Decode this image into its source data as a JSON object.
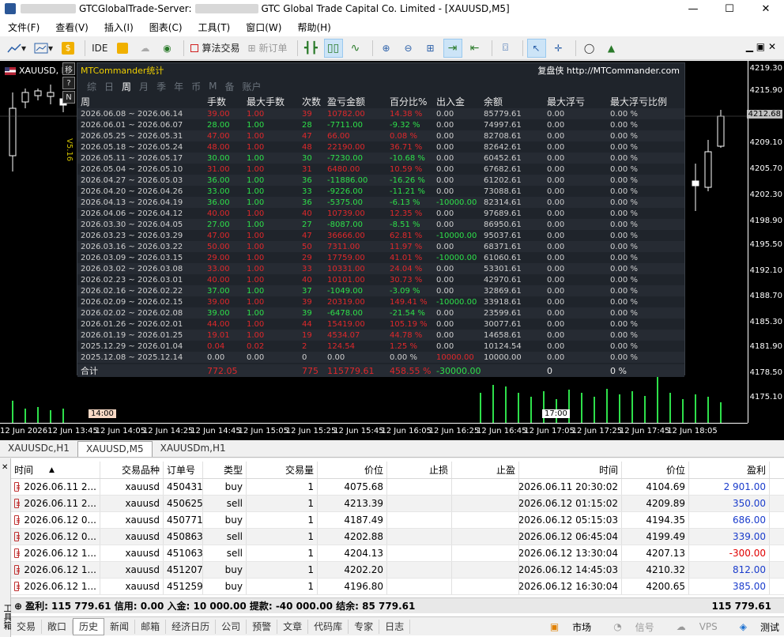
{
  "title": {
    "app": "GTCGlobalTrade-Server:",
    "company": "GTC Global Trade Capital Co. Limited - [XAUUSD,M5]"
  },
  "menu": [
    "文件(F)",
    "查看(V)",
    "插入(I)",
    "图表(C)",
    "工具(T)",
    "窗口(W)",
    "帮助(H)"
  ],
  "toolbar": {
    "ide": "IDE",
    "algo": "算法交易",
    "neworder": "新订单"
  },
  "chart": {
    "symbol": "XAUUSD, M5",
    "version": "V5.16",
    "side_buttons": [
      "移",
      "?",
      "N"
    ],
    "y_ticks": [
      "4219.30",
      "4215.90",
      "4212.68",
      "4209.10",
      "4205.70",
      "4202.30",
      "4198.90",
      "4195.50",
      "4192.10",
      "4188.70",
      "4185.30",
      "4181.90",
      "4178.50",
      "4175.10"
    ],
    "current_price": "4212.68",
    "x_ticks": [
      "12 Jun 2026",
      "12 Jun 13:45",
      "12 Jun 14:05",
      "12 Jun 14:25",
      "12 Jun 14:45",
      "12 Jun 15:05",
      "12 Jun 15:25",
      "12 Jun 15:45",
      "12 Jun 16:05",
      "12 Jun 16:25",
      "12 Jun 16:45",
      "12 Jun 17:05",
      "12 Jun 17:25",
      "12 Jun 17:45",
      "12 Jun 18:05"
    ],
    "marker_left": "14:00",
    "marker_right": "17:00"
  },
  "panel": {
    "title": "MTCommander统计",
    "link": "复盘侠 http://MTCommander.com",
    "tabs": [
      "综",
      "日",
      "周",
      "月",
      "季",
      "年",
      "币",
      "M",
      "备",
      "账户"
    ],
    "active_tab": "周",
    "headers": [
      "周",
      "手数",
      "最大手数",
      "次数",
      "盈亏金额",
      "百分比%",
      "出入金",
      "余额",
      "最大浮亏",
      "最大浮亏比例"
    ],
    "rows": [
      [
        "2026.06.08 ~ 2026.06.14",
        "39.00",
        "1.00",
        "39",
        "10782.00",
        "14.38 %",
        "0.00",
        "85779.61",
        "0.00",
        "0.00 %",
        "r"
      ],
      [
        "2026.06.01 ~ 2026.06.07",
        "28.00",
        "1.00",
        "28",
        "-7711.00",
        "-9.32 %",
        "0.00",
        "74997.61",
        "0.00",
        "0.00 %",
        "g"
      ],
      [
        "2026.05.25 ~ 2026.05.31",
        "47.00",
        "1.00",
        "47",
        "66.00",
        "0.08 %",
        "0.00",
        "82708.61",
        "0.00",
        "0.00 %",
        "r"
      ],
      [
        "2026.05.18 ~ 2026.05.24",
        "48.00",
        "1.00",
        "48",
        "22190.00",
        "36.71 %",
        "0.00",
        "82642.61",
        "0.00",
        "0.00 %",
        "r"
      ],
      [
        "2026.05.11 ~ 2026.05.17",
        "30.00",
        "1.00",
        "30",
        "-7230.00",
        "-10.68 %",
        "0.00",
        "60452.61",
        "0.00",
        "0.00 %",
        "g"
      ],
      [
        "2026.05.04 ~ 2026.05.10",
        "31.00",
        "1.00",
        "31",
        "6480.00",
        "10.59 %",
        "0.00",
        "67682.61",
        "0.00",
        "0.00 %",
        "r"
      ],
      [
        "2026.04.27 ~ 2026.05.03",
        "36.00",
        "1.00",
        "36",
        "-11886.00",
        "-16.26 %",
        "0.00",
        "61202.61",
        "0.00",
        "0.00 %",
        "g"
      ],
      [
        "2026.04.20 ~ 2026.04.26",
        "33.00",
        "1.00",
        "33",
        "-9226.00",
        "-11.21 %",
        "0.00",
        "73088.61",
        "0.00",
        "0.00 %",
        "g"
      ],
      [
        "2026.04.13 ~ 2026.04.19",
        "36.00",
        "1.00",
        "36",
        "-5375.00",
        "-6.13 %",
        "-10000.00",
        "82314.61",
        "0.00",
        "0.00 %",
        "g"
      ],
      [
        "2026.04.06 ~ 2026.04.12",
        "40.00",
        "1.00",
        "40",
        "10739.00",
        "12.35 %",
        "0.00",
        "97689.61",
        "0.00",
        "0.00 %",
        "r"
      ],
      [
        "2026.03.30 ~ 2026.04.05",
        "27.00",
        "1.00",
        "27",
        "-8087.00",
        "-8.51 %",
        "0.00",
        "86950.61",
        "0.00",
        "0.00 %",
        "g"
      ],
      [
        "2026.03.23 ~ 2026.03.29",
        "47.00",
        "1.00",
        "47",
        "36666.00",
        "62.81 %",
        "-10000.00",
        "95037.61",
        "0.00",
        "0.00 %",
        "r"
      ],
      [
        "2026.03.16 ~ 2026.03.22",
        "50.00",
        "1.00",
        "50",
        "7311.00",
        "11.97 %",
        "0.00",
        "68371.61",
        "0.00",
        "0.00 %",
        "r"
      ],
      [
        "2026.03.09 ~ 2026.03.15",
        "29.00",
        "1.00",
        "29",
        "17759.00",
        "41.01 %",
        "-10000.00",
        "61060.61",
        "0.00",
        "0.00 %",
        "r"
      ],
      [
        "2026.03.02 ~ 2026.03.08",
        "33.00",
        "1.00",
        "33",
        "10331.00",
        "24.04 %",
        "0.00",
        "53301.61",
        "0.00",
        "0.00 %",
        "r"
      ],
      [
        "2026.02.23 ~ 2026.03.01",
        "40.00",
        "1.00",
        "40",
        "10101.00",
        "30.73 %",
        "0.00",
        "42970.61",
        "0.00",
        "0.00 %",
        "r"
      ],
      [
        "2026.02.16 ~ 2026.02.22",
        "37.00",
        "1.00",
        "37",
        "-1049.00",
        "-3.09 %",
        "0.00",
        "32869.61",
        "0.00",
        "0.00 %",
        "g"
      ],
      [
        "2026.02.09 ~ 2026.02.15",
        "39.00",
        "1.00",
        "39",
        "20319.00",
        "149.41 %",
        "-10000.00",
        "33918.61",
        "0.00",
        "0.00 %",
        "r"
      ],
      [
        "2026.02.02 ~ 2026.02.08",
        "39.00",
        "1.00",
        "39",
        "-6478.00",
        "-21.54 %",
        "0.00",
        "23599.61",
        "0.00",
        "0.00 %",
        "g"
      ],
      [
        "2026.01.26 ~ 2026.02.01",
        "44.00",
        "1.00",
        "44",
        "15419.00",
        "105.19 %",
        "0.00",
        "30077.61",
        "0.00",
        "0.00 %",
        "r"
      ],
      [
        "2026.01.19 ~ 2026.01.25",
        "19.01",
        "1.00",
        "19",
        "4534.07",
        "44.78 %",
        "0.00",
        "14658.61",
        "0.00",
        "0.00 %",
        "r"
      ],
      [
        "2025.12.29 ~ 2026.01.04",
        "0.04",
        "0.02",
        "2",
        "124.54",
        "1.25 %",
        "0.00",
        "10124.54",
        "0.00",
        "0.00 %",
        "r"
      ],
      [
        "2025.12.08 ~ 2025.12.14",
        "0.00",
        "0.00",
        "0",
        "0.00",
        "0.00 %",
        "10000.00",
        "10000.00",
        "0.00",
        "0.00 %",
        "w"
      ]
    ],
    "summary": [
      "合计",
      "772.05",
      "",
      "775",
      "115779.61",
      "458.55 %",
      "-30000.00",
      "",
      "0",
      "0 %"
    ]
  },
  "chart_tabs": [
    "XAUUSDc,H1",
    "XAUUSD,M5",
    "XAUUSDm,H1"
  ],
  "active_chart_tab": "XAUUSD,M5",
  "history": {
    "headers": [
      "时间",
      "交易品种",
      "订单号",
      "类型",
      "交易量",
      "价位",
      "止损",
      "止盈",
      "时间",
      "价位",
      "盈利"
    ],
    "rows": [
      [
        "2026.06.11 2...",
        "xauusd",
        "450431...",
        "buy",
        "1",
        "4075.68",
        "",
        "",
        "2026.06.11 20:30:02",
        "4104.69",
        "2 901.00",
        "pos"
      ],
      [
        "2026.06.11 2...",
        "xauusd",
        "450625...",
        "sell",
        "1",
        "4213.39",
        "",
        "",
        "2026.06.12 01:15:02",
        "4209.89",
        "350.00",
        "pos"
      ],
      [
        "2026.06.12 0...",
        "xauusd",
        "450771...",
        "buy",
        "1",
        "4187.49",
        "",
        "",
        "2026.06.12 05:15:03",
        "4194.35",
        "686.00",
        "pos"
      ],
      [
        "2026.06.12 0...",
        "xauusd",
        "450863...",
        "sell",
        "1",
        "4202.88",
        "",
        "",
        "2026.06.12 06:45:04",
        "4199.49",
        "339.00",
        "pos"
      ],
      [
        "2026.06.12 1...",
        "xauusd",
        "451063...",
        "sell",
        "1",
        "4204.13",
        "",
        "",
        "2026.06.12 13:30:04",
        "4207.13",
        "-300.00",
        "neg"
      ],
      [
        "2026.06.12 1...",
        "xauusd",
        "451207...",
        "buy",
        "1",
        "4202.20",
        "",
        "",
        "2026.06.12 14:45:03",
        "4210.32",
        "812.00",
        "pos"
      ],
      [
        "2026.06.12 1...",
        "xauusd",
        "451259...",
        "buy",
        "1",
        "4196.80",
        "",
        "",
        "2026.06.12 16:30:04",
        "4200.65",
        "385.00",
        "pos"
      ]
    ],
    "summary": "盈利: 115 779.61  信用: 0.00  入金: 10 000.00  提款: -40 000.00  结余: 85 779.61",
    "summary_total": "115 779.61"
  },
  "bottom_tabs": [
    "交易",
    "敞口",
    "历史",
    "新闻",
    "邮箱",
    "经济日历",
    "公司",
    "预警",
    "文章",
    "代码库",
    "专家",
    "日志"
  ],
  "active_bottom_tab": "历史",
  "status": {
    "market": "市场",
    "signal": "信号",
    "vps": "VPS",
    "tester": "测试"
  },
  "toolbox_label": "工具箱"
}
